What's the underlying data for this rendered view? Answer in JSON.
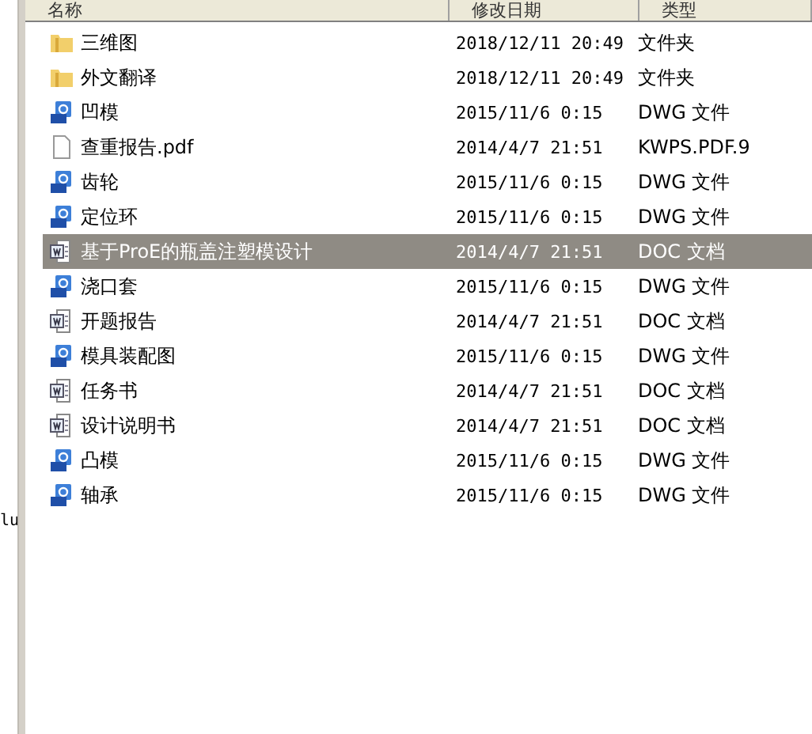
{
  "sidebar": {
    "text": "lu"
  },
  "columns": [
    "名称",
    "修改日期",
    "类型"
  ],
  "files": [
    {
      "kind": "folder",
      "name": "三维图",
      "date": "2018/12/11 20:49",
      "type": "文件夹",
      "selected": false
    },
    {
      "kind": "folder",
      "name": "外文翻译",
      "date": "2018/12/11 20:49",
      "type": "文件夹",
      "selected": false
    },
    {
      "kind": "dwg",
      "name": "凹模",
      "date": "2015/11/6 0:15",
      "type": "DWG 文件",
      "selected": false
    },
    {
      "kind": "pdf",
      "name": "查重报告.pdf",
      "date": "2014/4/7 21:51",
      "type": "KWPS.PDF.9",
      "selected": false
    },
    {
      "kind": "dwg",
      "name": "齿轮",
      "date": "2015/11/6 0:15",
      "type": "DWG 文件",
      "selected": false
    },
    {
      "kind": "dwg",
      "name": "定位环",
      "date": "2015/11/6 0:15",
      "type": "DWG 文件",
      "selected": false
    },
    {
      "kind": "doc",
      "name": "基于ProE的瓶盖注塑模设计",
      "date": "2014/4/7 21:51",
      "type": "DOC 文档",
      "selected": true
    },
    {
      "kind": "dwg",
      "name": "浇口套",
      "date": "2015/11/6 0:15",
      "type": "DWG 文件",
      "selected": false
    },
    {
      "kind": "doc",
      "name": "开题报告",
      "date": "2014/4/7 21:51",
      "type": "DOC 文档",
      "selected": false
    },
    {
      "kind": "dwg",
      "name": "模具装配图",
      "date": "2015/11/6 0:15",
      "type": "DWG 文件",
      "selected": false
    },
    {
      "kind": "doc",
      "name": "任务书",
      "date": "2014/4/7 21:51",
      "type": "DOC 文档",
      "selected": false
    },
    {
      "kind": "doc",
      "name": "设计说明书",
      "date": "2014/4/7 21:51",
      "type": "DOC 文档",
      "selected": false
    },
    {
      "kind": "dwg",
      "name": "凸模",
      "date": "2015/11/6 0:15",
      "type": "DWG 文件",
      "selected": false
    },
    {
      "kind": "dwg",
      "name": "轴承",
      "date": "2015/11/6 0:15",
      "type": "DWG 文件",
      "selected": false
    }
  ]
}
